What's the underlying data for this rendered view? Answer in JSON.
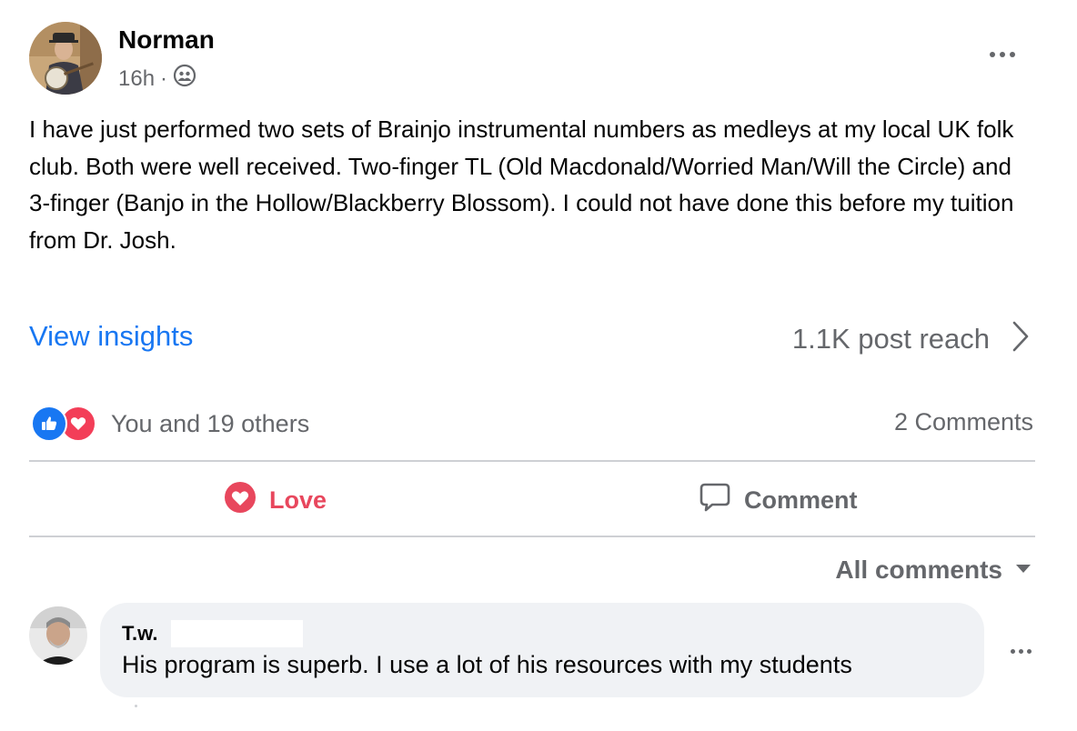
{
  "post": {
    "author": "Norman",
    "time": "16h",
    "separator": "·",
    "audience_icon": "friends-icon",
    "text": "I have just performed two sets of Brainjo instrumental numbers as medleys at my local UK folk club. Both were well received. Two-finger TL  (Old Macdonald/Worried Man/Will the Circle) and 3-finger (Banjo in the Hollow/Blackberry Blossom). I could not have done this before my tuition from Dr. Josh.",
    "view_insights": "View insights",
    "reach": "1.1K post reach",
    "reactions_text": "You and 19 others",
    "comments_count": "2 Comments",
    "reaction_icons": [
      "like-icon",
      "love-icon"
    ]
  },
  "actions": {
    "love": "Love",
    "comment": "Comment"
  },
  "comments_filter": {
    "label": "All comments"
  },
  "comments": [
    {
      "author": "T.w.",
      "text": "His program is superb. I use a lot of his resources with my students"
    }
  ],
  "colors": {
    "link_blue": "#1877f2",
    "love_red": "#e8475d",
    "secondary_text": "#65676b",
    "bubble_bg": "#f0f2f5"
  }
}
